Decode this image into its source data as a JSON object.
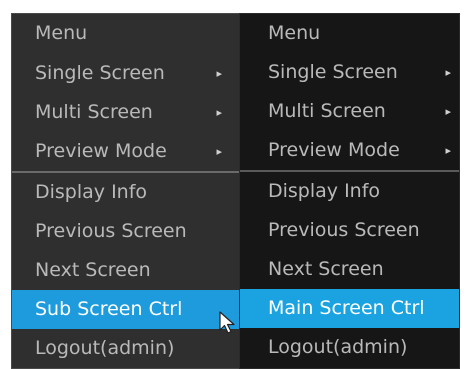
{
  "left_menu": {
    "items": [
      {
        "label": "Menu",
        "arrow": ""
      },
      {
        "label": "Single Screen",
        "arrow": "▸"
      },
      {
        "label": "Multi Screen",
        "arrow": "▸"
      },
      {
        "label": "Preview Mode",
        "arrow": "▸"
      },
      {
        "label": "Display Info",
        "arrow": ""
      },
      {
        "label": "Previous Screen",
        "arrow": ""
      },
      {
        "label": "Next Screen",
        "arrow": ""
      },
      {
        "label": "Sub Screen Ctrl",
        "arrow": "",
        "selected": true
      },
      {
        "label": "Logout(admin)",
        "arrow": ""
      }
    ]
  },
  "right_menu": {
    "items": [
      {
        "label": "Menu",
        "arrow": ""
      },
      {
        "label": "Single Screen",
        "arrow": "▸"
      },
      {
        "label": "Multi Screen",
        "arrow": "▸"
      },
      {
        "label": "Preview Mode",
        "arrow": "▸"
      },
      {
        "label": "Display Info",
        "arrow": ""
      },
      {
        "label": "Previous Screen",
        "arrow": ""
      },
      {
        "label": "Next Screen",
        "arrow": ""
      },
      {
        "label": "Main Screen Ctrl",
        "arrow": "",
        "selected": true
      },
      {
        "label": "Logout(admin)",
        "arrow": ""
      }
    ]
  },
  "colors": {
    "highlight": "#1e9bdc",
    "text": "#b9b9b9",
    "selected_text": "#ffffff"
  },
  "cursor_icon": "mouse-pointer-icon"
}
